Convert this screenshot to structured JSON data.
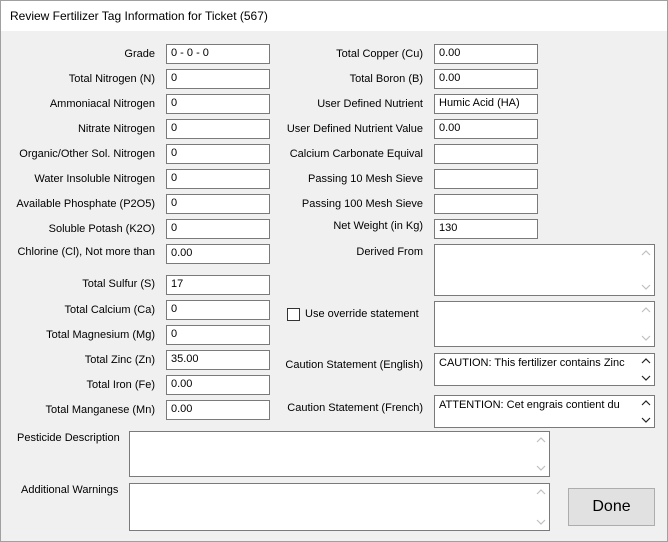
{
  "window": {
    "title": "Review Fertilizer Tag Information for Ticket (567)"
  },
  "left_fields": [
    {
      "label": "Grade",
      "value": "0 - 0 - 0"
    },
    {
      "label": "Total Nitrogen (N)",
      "value": "0"
    },
    {
      "label": "Ammoniacal Nitrogen",
      "value": "0"
    },
    {
      "label": "Nitrate Nitrogen",
      "value": "0"
    },
    {
      "label": "Organic/Other Sol. Nitrogen",
      "value": "0"
    },
    {
      "label": "Water Insoluble Nitrogen",
      "value": "0"
    },
    {
      "label": "Available Phosphate (P2O5)",
      "value": "0"
    },
    {
      "label": "Soluble Potash (K2O)",
      "value": "0"
    },
    {
      "label": "Chlorine (Cl), Not more than",
      "value": "0.00"
    },
    {
      "label": "Total Sulfur (S)",
      "value": "17"
    },
    {
      "label": "Total Calcium (Ca)",
      "value": "0"
    },
    {
      "label": "Total Magnesium (Mg)",
      "value": "0"
    },
    {
      "label": "Total Zinc (Zn)",
      "value": "35.00"
    },
    {
      "label": "Total Iron (Fe)",
      "value": "0.00"
    },
    {
      "label": "Total Manganese (Mn)",
      "value": "0.00"
    }
  ],
  "right_fields": [
    {
      "label": "Total Copper (Cu)",
      "value": "0.00"
    },
    {
      "label": "Total Boron (B)",
      "value": "0.00"
    },
    {
      "label": "User Defined Nutrient",
      "value": "Humic Acid (HA)"
    },
    {
      "label": "User Defined Nutrient Value",
      "value": "0.00"
    },
    {
      "label": "Calcium Carbonate Equival",
      "value": ""
    },
    {
      "label": "Passing 10 Mesh Sieve",
      "value": ""
    },
    {
      "label": "Passing 100 Mesh Sieve",
      "value": ""
    },
    {
      "label": "Net Weight (in Kg)",
      "value": "130"
    }
  ],
  "derived_from": {
    "label": "Derived From",
    "value": ""
  },
  "override": {
    "label": "Use override statement",
    "checked": false,
    "value": ""
  },
  "caution_english": {
    "label": "Caution Statement (English)",
    "value": "CAUTION: This fertilizer contains Zinc"
  },
  "caution_french": {
    "label": "Caution Statement (French)",
    "value": "ATTENTION: Cet engrais contient du"
  },
  "pesticide": {
    "label": "Pesticide Description",
    "value": ""
  },
  "warnings": {
    "label": "Additional Warnings",
    "value": ""
  },
  "done_button": {
    "label": "Done"
  }
}
